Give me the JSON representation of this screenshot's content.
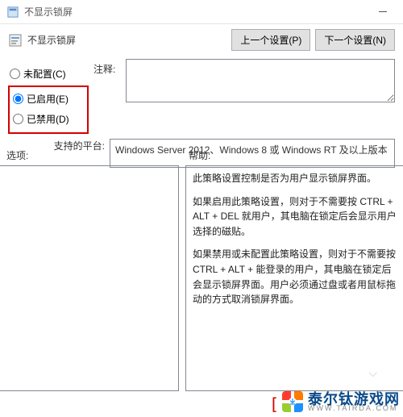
{
  "titlebar": {
    "title": "不显示锁屏"
  },
  "header": {
    "policy_name": "不显示锁屏",
    "prev_btn": "上一个设置(P)",
    "next_btn": "下一个设置(N)"
  },
  "radios": {
    "not_configured": "未配置(C)",
    "enabled": "已启用(E)",
    "disabled": "已禁用(D)"
  },
  "labels": {
    "comment": "注释:",
    "platform": "支持的平台:",
    "options": "选项:",
    "help": "帮助:"
  },
  "platform_text": "Windows Server 2012、Windows 8 或 Windows RT 及以上版本",
  "help": {
    "p1": "此策略设置控制是否为用户显示锁屏界面。",
    "p2": "如果启用此策略设置，则对于不需要按 CTRL + ALT + DEL 就用户，其电脑在锁定后会显示用户选择的磁贴。",
    "p3": "如果禁用或未配置此策略设置，则对于不需要按 CTRL + ALT + 能登录的用户，其电脑在锁定后会显示锁屏界面。用户必须通过盘或者用鼠标拖动的方式取消锁屏界面。"
  },
  "watermark": {
    "brand": "泰尔钛游戏网",
    "domain": "WWW.TAIRDA.COM"
  }
}
